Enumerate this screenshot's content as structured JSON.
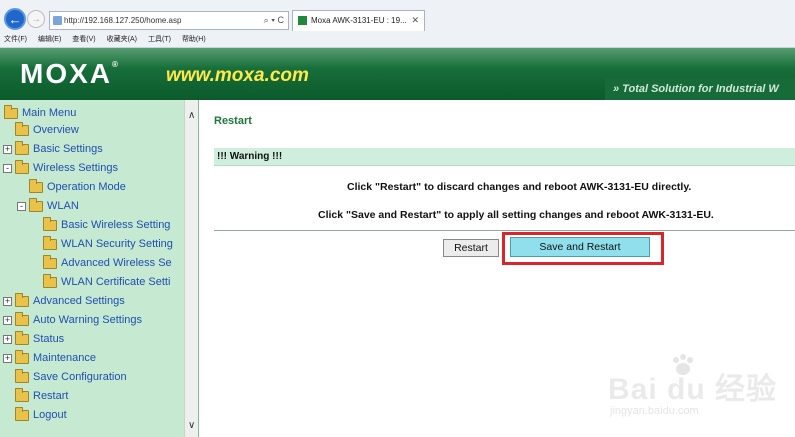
{
  "browser": {
    "address": "http://192.168.127.250/home.asp",
    "address_controls": "⌕ ▾ C",
    "tab_title": "Moxa AWK-3131-EU : 19...",
    "menubar": [
      "文件(F)",
      "编辑(E)",
      "查看(V)",
      "收藏夹(A)",
      "工具(T)",
      "帮助(H)"
    ]
  },
  "banner": {
    "logo": "MOXA",
    "logo_mark": "®",
    "site": "www.moxa.com",
    "tagline": "» Total Solution for Industrial W"
  },
  "menu": {
    "items": [
      {
        "label": "Main Menu",
        "level": 0,
        "expander": ""
      },
      {
        "label": "Overview",
        "level": 1,
        "expander": ""
      },
      {
        "label": "Basic Settings",
        "level": 1,
        "expander": "+"
      },
      {
        "label": "Wireless Settings",
        "level": 1,
        "expander": "-"
      },
      {
        "label": "Operation Mode",
        "level": 2,
        "expander": ""
      },
      {
        "label": "WLAN",
        "level": 2,
        "expander": "-"
      },
      {
        "label": "Basic Wireless Setting",
        "level": 3,
        "expander": ""
      },
      {
        "label": "WLAN Security Setting",
        "level": 3,
        "expander": ""
      },
      {
        "label": "Advanced Wireless Se",
        "level": 3,
        "expander": ""
      },
      {
        "label": "WLAN Certificate Setti",
        "level": 3,
        "expander": ""
      },
      {
        "label": "Advanced Settings",
        "level": 1,
        "expander": "+"
      },
      {
        "label": "Auto Warning Settings",
        "level": 1,
        "expander": "+"
      },
      {
        "label": "Status",
        "level": 1,
        "expander": "+"
      },
      {
        "label": "Maintenance",
        "level": 1,
        "expander": "+"
      },
      {
        "label": "Save Configuration",
        "level": 1,
        "expander": ""
      },
      {
        "label": "Restart",
        "level": 1,
        "expander": ""
      },
      {
        "label": "Logout",
        "level": 1,
        "expander": ""
      }
    ]
  },
  "content": {
    "title": "Restart",
    "warning": "!!! Warning !!!",
    "message1": "Click \"Restart\" to discard changes and reboot AWK-3131-EU directly.",
    "message2": "Click \"Save and Restart\" to apply all setting changes and reboot AWK-3131-EU.",
    "restart_label": "Restart",
    "save_restart_label": "Save and Restart"
  },
  "watermark": {
    "logo": "Bai  du 经验",
    "url": "jingyan.baidu.com"
  },
  "colors": {
    "banner_green": "#0b5a2b",
    "menu_bg": "#c6e9d2",
    "highlight": "#d9252b",
    "save_button": "#8fe0ec"
  }
}
